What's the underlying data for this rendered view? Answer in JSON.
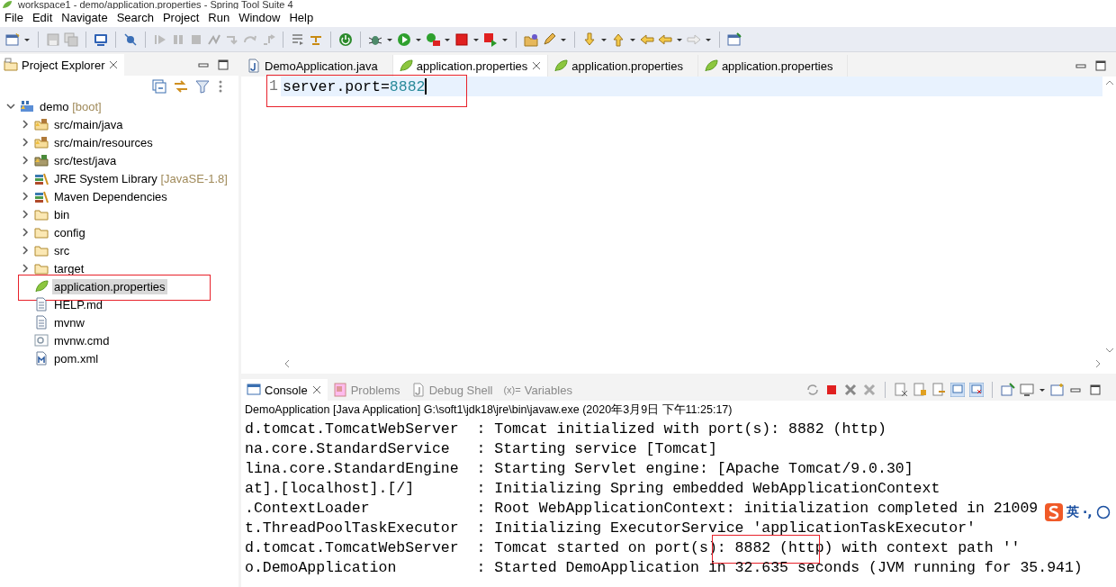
{
  "window": {
    "title": "workspace1 - demo/application.properties - Spring Tool Suite 4"
  },
  "menu": [
    "File",
    "Edit",
    "Navigate",
    "Search",
    "Project",
    "Run",
    "Window",
    "Help"
  ],
  "explorer": {
    "title": "Project Explorer",
    "tree": [
      {
        "label": "demo",
        "decoration": "[boot]",
        "kind": "project",
        "expanded": true,
        "selected": false,
        "highlighted": false,
        "children": [
          {
            "label": "src/main/java",
            "kind": "source-folder",
            "expanded": false,
            "selected": false,
            "highlighted": false
          },
          {
            "label": "src/main/resources",
            "kind": "source-folder",
            "expanded": false,
            "selected": false,
            "highlighted": false
          },
          {
            "label": "src/test/java",
            "kind": "test-folder",
            "expanded": false,
            "selected": false,
            "highlighted": false
          },
          {
            "label": "JRE System Library",
            "decoration": "[JavaSE-1.8]",
            "kind": "library",
            "expanded": false,
            "selected": false,
            "highlighted": false
          },
          {
            "label": "Maven Dependencies",
            "kind": "library",
            "expanded": false,
            "selected": false,
            "highlighted": false
          },
          {
            "label": "bin",
            "kind": "folder",
            "expanded": false,
            "selected": false,
            "highlighted": false
          },
          {
            "label": "config",
            "kind": "folder",
            "expanded": false,
            "selected": false,
            "highlighted": false
          },
          {
            "label": "src",
            "kind": "folder",
            "expanded": false,
            "selected": false,
            "highlighted": false
          },
          {
            "label": "target",
            "kind": "folder",
            "expanded": false,
            "selected": false,
            "highlighted": false
          },
          {
            "label": "application.properties",
            "kind": "properties",
            "selected": true,
            "highlighted": true
          },
          {
            "label": "HELP.md",
            "kind": "file",
            "selected": false,
            "highlighted": false
          },
          {
            "label": "mvnw",
            "kind": "file",
            "selected": false,
            "highlighted": false
          },
          {
            "label": "mvnw.cmd",
            "kind": "script",
            "selected": false,
            "highlighted": false
          },
          {
            "label": "pom.xml",
            "kind": "xml",
            "selected": false,
            "highlighted": false
          }
        ]
      }
    ]
  },
  "editor": {
    "tabs": [
      {
        "label": "DemoApplication.java",
        "kind": "java",
        "selected": false
      },
      {
        "label": "application.properties",
        "kind": "properties",
        "selected": true
      },
      {
        "label": "application.properties",
        "kind": "properties",
        "selected": false
      },
      {
        "label": "application.properties",
        "kind": "properties",
        "selected": false
      }
    ],
    "lines": [
      {
        "number": "1",
        "key": "server.port=",
        "value": "8882",
        "current": true,
        "highlighted": true
      }
    ]
  },
  "console": {
    "tabs": [
      {
        "label": "Console",
        "kind": "console",
        "selected": true
      },
      {
        "label": "Problems",
        "kind": "problems",
        "selected": false
      },
      {
        "label": "Debug Shell",
        "kind": "debug-shell",
        "selected": false
      },
      {
        "label": "Variables",
        "kind": "variables",
        "icon_text": "(x)=",
        "selected": false
      }
    ],
    "process": "DemoApplication [Java Application] G:\\soft1\\jdk18\\jre\\bin\\javaw.exe (2020年3月9日 下午11:25:17)",
    "lines": [
      {
        "text": "d.tomcat.TomcatWebServer  : Tomcat initialized with port(s): 8882 (http)",
        "highlighted": false
      },
      {
        "text": "na.core.StandardService   : Starting service [Tomcat]",
        "highlighted": false
      },
      {
        "text": "lina.core.StandardEngine  : Starting Servlet engine: [Apache Tomcat/9.0.30]",
        "highlighted": false
      },
      {
        "text": "at].[localhost].[/]       : Initializing Spring embedded WebApplicationContext",
        "highlighted": false
      },
      {
        "text": ".ContextLoader            : Root WebApplicationContext: initialization completed in 21009",
        "highlighted": false
      },
      {
        "text": "t.ThreadPoolTaskExecutor  : Initializing ExecutorService 'applicationTaskExecutor'",
        "highlighted": false
      },
      {
        "text": "d.tomcat.TomcatWebServer  : Tomcat started on port(s): 8882 (http) with context path ''",
        "highlighted": true
      },
      {
        "text": "o.DemoApplication         : Started DemoApplication in 32.635 seconds (JVM running for 35.941)",
        "highlighted": false
      }
    ]
  },
  "ime": {
    "mode": "英",
    "punct": "·,"
  }
}
